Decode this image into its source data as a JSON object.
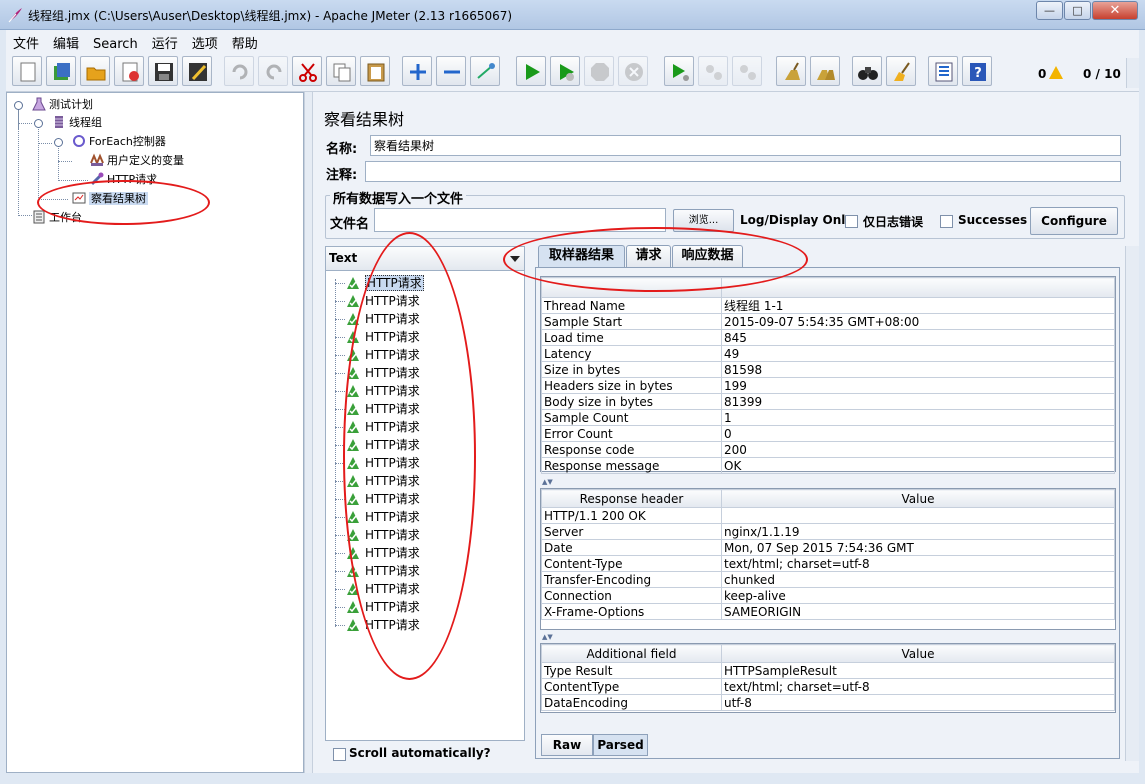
{
  "window": {
    "title": "线程组.jmx (C:\\Users\\Auser\\Desktop\\线程组.jmx) - Apache JMeter (2.13 r1665067)",
    "minimize": "—",
    "maximize": "□",
    "close": "✕"
  },
  "menu": [
    "文件",
    "编辑",
    "Search",
    "运行",
    "选项",
    "帮助"
  ],
  "status": {
    "errors": "0",
    "threads": "0 / 10"
  },
  "tree": {
    "test_plan": "测试计划",
    "thread_group": "线程组",
    "foreach": "ForEach控制器",
    "user_vars": "用户定义的变量",
    "http_request": "HTTP请求",
    "view_results": "察看结果树",
    "workbench": "工作台"
  },
  "panel": {
    "title": "察看结果树",
    "name_label": "名称:",
    "name_value": "察看结果树",
    "comment_label": "注释:",
    "comment_value": "",
    "file_group_label": "所有数据写入一个文件",
    "filename_label": "文件名",
    "filename_value": "",
    "browse_label": "浏览...",
    "log_display_label": "Log/Display Only:",
    "errors_only_label": "仅日志错误",
    "successes_label": "Successes",
    "configure_label": "Configure"
  },
  "results": {
    "renderer": "Text",
    "items": [
      "HTTP请求",
      "HTTP请求",
      "HTTP请求",
      "HTTP请求",
      "HTTP请求",
      "HTTP请求",
      "HTTP请求",
      "HTTP请求",
      "HTTP请求",
      "HTTP请求",
      "HTTP请求",
      "HTTP请求",
      "HTTP请求",
      "HTTP请求",
      "HTTP请求",
      "HTTP请求",
      "HTTP请求",
      "HTTP请求",
      "HTTP请求",
      "HTTP请求"
    ],
    "scroll_auto_label": "Scroll automatically?"
  },
  "tabs": [
    "取样器结果",
    "请求",
    "响应数据"
  ],
  "sampler_table": {
    "rows": [
      [
        "Thread Name",
        "线程组 1-1"
      ],
      [
        "Sample Start",
        "2015-09-07   5:54:35 GMT+08:00"
      ],
      [
        "Load time",
        "845"
      ],
      [
        "Latency",
        "49"
      ],
      [
        "Size in bytes",
        "81598"
      ],
      [
        "Headers size in bytes",
        "199"
      ],
      [
        "Body size in bytes",
        "81399"
      ],
      [
        "Sample Count",
        "1"
      ],
      [
        "Error Count",
        "0"
      ],
      [
        "Response code",
        "200"
      ],
      [
        "Response message",
        "OK"
      ]
    ]
  },
  "header_table": {
    "columns": [
      "Response header",
      "Value"
    ],
    "rows": [
      [
        "HTTP/1.1 200 OK",
        ""
      ],
      [
        "Server",
        "nginx/1.1.19"
      ],
      [
        "Date",
        "Mon, 07 Sep 2015   7:54:36 GMT"
      ],
      [
        "Content-Type",
        "text/html; charset=utf-8"
      ],
      [
        "Transfer-Encoding",
        "chunked"
      ],
      [
        "Connection",
        "keep-alive"
      ],
      [
        "X-Frame-Options",
        "SAMEORIGIN"
      ]
    ]
  },
  "additional_table": {
    "columns": [
      "Additional field",
      "Value"
    ],
    "rows": [
      [
        "Type Result",
        "HTTPSampleResult"
      ],
      [
        "ContentType",
        "text/html; charset=utf-8"
      ],
      [
        "DataEncoding",
        "utf-8"
      ]
    ]
  },
  "bottom_tabs": [
    "Raw",
    "Parsed"
  ],
  "annotation_color": "#e31b1b"
}
